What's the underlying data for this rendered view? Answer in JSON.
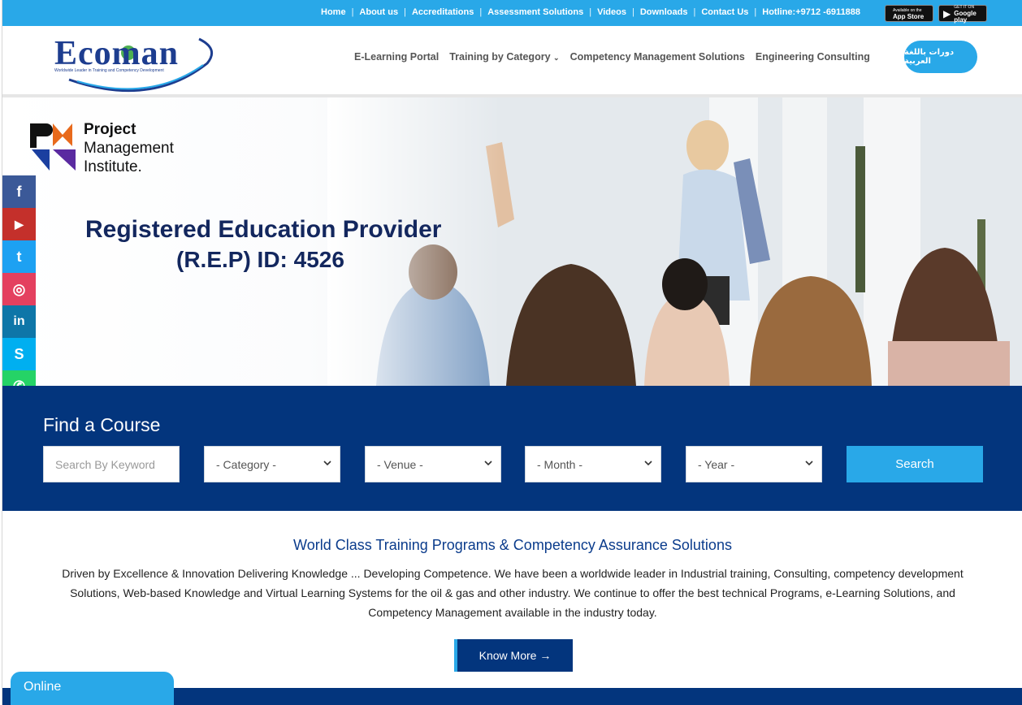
{
  "topbar": {
    "links": [
      "Home",
      "About us",
      "Accreditations",
      "Assessment Solutions",
      "Videos",
      "Downloads",
      "Contact Us"
    ],
    "hotline": "Hotline:+9712 -6911888",
    "appstore": {
      "small": "Available on the",
      "big": "App Store"
    },
    "googleplay": {
      "small": "GET IT ON",
      "big": "Google play"
    }
  },
  "header": {
    "logo_word": "Ecoman",
    "logo_tagline": "Worldwide Leader in Training and Competency Development",
    "nav": [
      "E-Learning Portal",
      "Training by Category",
      "Competency Management Solutions",
      "Engineering Consulting"
    ],
    "arabic_button": "دورات باللغة العربية"
  },
  "hero": {
    "pmi_lines": [
      "Project",
      "Management",
      "Institute."
    ],
    "title": "Registered Education Provider",
    "subtitle": "(R.E.P) ID: 4526"
  },
  "social": [
    {
      "icon": "facebook-icon",
      "glyph": "f",
      "color": "#3b5998"
    },
    {
      "icon": "youtube-icon",
      "glyph": "▶",
      "color": "#c4302b"
    },
    {
      "icon": "twitter-icon",
      "glyph": "t",
      "color": "#1da1f2"
    },
    {
      "icon": "instagram-icon",
      "glyph": "◎",
      "color": "#e4405f"
    },
    {
      "icon": "linkedin-icon",
      "glyph": "in",
      "color": "#0e76a8"
    },
    {
      "icon": "skype-icon",
      "glyph": "S",
      "color": "#00aff0"
    },
    {
      "icon": "whatsapp-icon",
      "glyph": "✆",
      "color": "#25d366"
    }
  ],
  "find_course": {
    "heading": "Find a Course",
    "keyword_placeholder": "Search By Keyword",
    "category": "- Category -",
    "venue": "- Venue -",
    "month": "- Month -",
    "year": "- Year -",
    "search_label": "Search"
  },
  "intro": {
    "title": "World Class Training Programs & Competency Assurance Solutions",
    "text": "Driven by Excellence & Innovation Delivering Knowledge ... Developing Competence. We have been a worldwide leader in Industrial training, Consulting, competency development Solutions, Web-based Knowledge and Virtual Learning Systems for the oil & gas and other industry. We continue to offer the best technical Programs, e-Learning Solutions, and Competency Management available in the industry today.",
    "button": "Know More →"
  },
  "chat": {
    "label": "Online"
  }
}
